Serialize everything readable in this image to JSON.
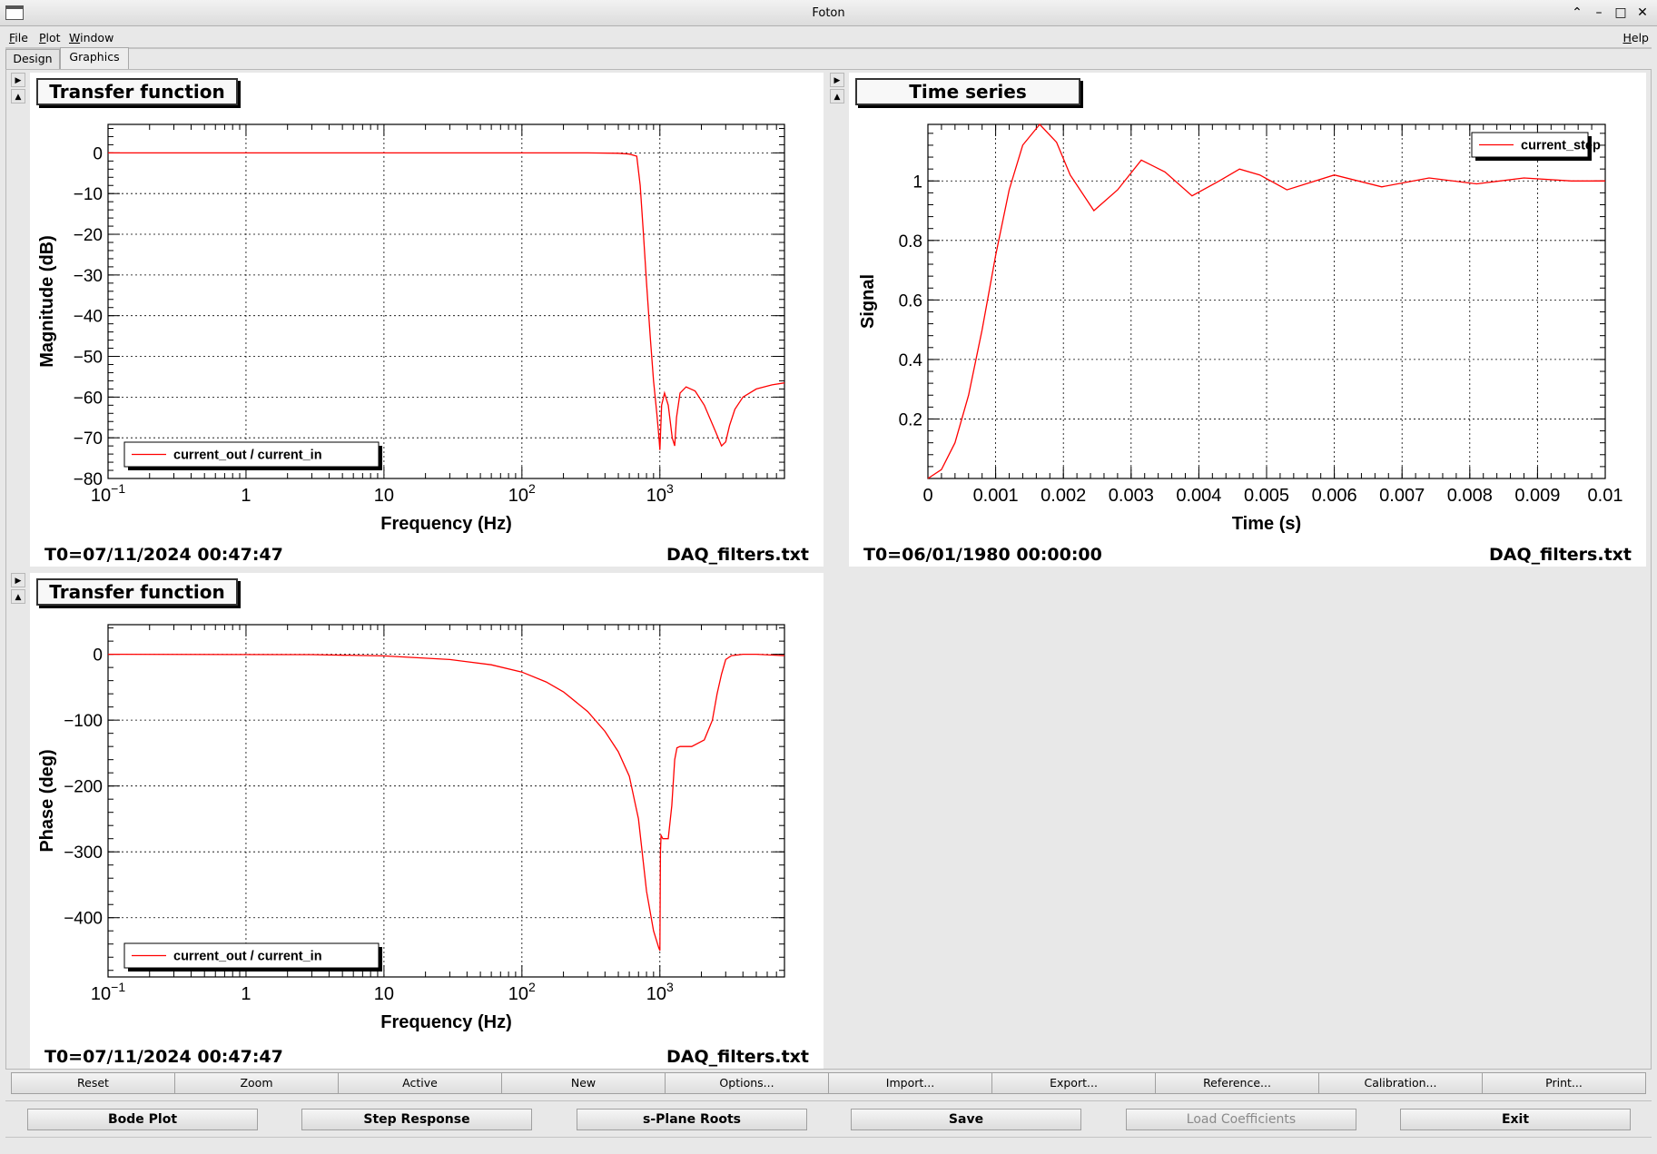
{
  "window": {
    "title": "Foton"
  },
  "window_buttons": [
    {
      "name": "shade-button",
      "glyph": "⌃"
    },
    {
      "name": "minimize-button",
      "glyph": "–"
    },
    {
      "name": "maximize-button",
      "glyph": "□"
    },
    {
      "name": "close-button",
      "glyph": "✕"
    }
  ],
  "menu": {
    "file": "File",
    "plot": "Plot",
    "window": "Window",
    "help": "Help"
  },
  "tabs": {
    "design": "Design",
    "graphics": "Graphics",
    "active": "Graphics"
  },
  "side_buttons": {
    "expand": "▶",
    "collapse": "▲"
  },
  "panels": {
    "mag": {
      "title": "Transfer function",
      "t0": "T0=07/11/2024 00:47:47",
      "file": "DAQ_filters.txt"
    },
    "step": {
      "title": "Time series",
      "t0": "T0=06/01/1980 00:00:00",
      "file": "DAQ_filters.txt"
    },
    "phase": {
      "title": "Transfer function",
      "t0": "T0=07/11/2024 00:47:47",
      "file": "DAQ_filters.txt"
    }
  },
  "toolbar": [
    "Reset",
    "Zoom",
    "Active",
    "New",
    "Options...",
    "Import...",
    "Export...",
    "Reference...",
    "Calibration...",
    "Print..."
  ],
  "actions": {
    "bode": "Bode Plot",
    "step": "Step Response",
    "splane": "s-Plane Roots",
    "save": "Save",
    "load": "Load Coefficients",
    "exit": "Exit"
  },
  "colors": {
    "trace": "#ff0000",
    "background": "#e8e8e8",
    "pad": "#ffffff"
  },
  "chart_data": [
    {
      "type": "line",
      "title": "Transfer function",
      "xlabel": "Frequency (Hz)",
      "ylabel": "Magnitude (dB)",
      "xscale": "log",
      "xlim": [
        0.1,
        8000
      ],
      "ylim": [
        -80,
        7
      ],
      "xticks": [
        0.1,
        1,
        10,
        100,
        1000
      ],
      "xticklabels": [
        "10",
        "1",
        "10",
        "10",
        "10"
      ],
      "xtickexp": [
        "−1",
        "",
        "",
        "2",
        "3"
      ],
      "yticks": [
        0,
        -10,
        -20,
        -30,
        -40,
        -50,
        -60,
        -70,
        -80
      ],
      "yticklabels": [
        "0",
        "−10",
        "−20",
        "−30",
        "−40",
        "−50",
        "−60",
        "−70",
        "−80"
      ],
      "grid": true,
      "legend_position": "bottom-left",
      "series": [
        {
          "name": "current_out / current_in",
          "x": [
            0.1,
            100,
            300,
            500,
            600,
            680,
            720,
            760,
            800,
            850,
            900,
            950,
            985,
            1000,
            1030,
            1080,
            1150,
            1230,
            1280,
            1320,
            1400,
            1550,
            1800,
            2100,
            2500,
            2800,
            3000,
            3200,
            3500,
            4000,
            5000,
            6500,
            8000
          ],
          "y": [
            0,
            0,
            0,
            -0.1,
            -0.3,
            -0.8,
            -8,
            -20,
            -32,
            -45,
            -56,
            -64,
            -70,
            -73,
            -62,
            -59,
            -62,
            -70,
            -72,
            -65,
            -59,
            -57.5,
            -58.5,
            -62,
            -68,
            -72,
            -71,
            -67,
            -63,
            -60,
            -58,
            -57,
            -56.5
          ]
        }
      ]
    },
    {
      "type": "line",
      "title": "Time series",
      "xlabel": "Time (s)",
      "ylabel": "Signal",
      "xlim": [
        0,
        0.01
      ],
      "ylim": [
        0,
        1.19
      ],
      "xticks": [
        0,
        0.001,
        0.002,
        0.003,
        0.004,
        0.005,
        0.006,
        0.007,
        0.008,
        0.009,
        0.01
      ],
      "xticklabels": [
        "0",
        "0.001",
        "0.002",
        "0.003",
        "0.004",
        "0.005",
        "0.006",
        "0.007",
        "0.008",
        "0.009",
        "0.01"
      ],
      "yticks": [
        0.2,
        0.4,
        0.6,
        0.8,
        1
      ],
      "yticklabels": [
        "0.2",
        "0.4",
        "0.6",
        "0.8",
        "1"
      ],
      "grid": true,
      "legend_position": "top-right",
      "series": [
        {
          "name": "current_step",
          "x": [
            0,
            0.0002,
            0.0004,
            0.0006,
            0.0008,
            0.001,
            0.0012,
            0.0014,
            0.00165,
            0.0019,
            0.0021,
            0.00245,
            0.0028,
            0.00315,
            0.0035,
            0.0039,
            0.0043,
            0.0046,
            0.0049,
            0.0053,
            0.006,
            0.0067,
            0.0074,
            0.0081,
            0.0088,
            0.0095,
            0.01
          ],
          "y": [
            0,
            0.03,
            0.12,
            0.28,
            0.5,
            0.75,
            0.97,
            1.12,
            1.19,
            1.13,
            1.02,
            0.9,
            0.97,
            1.07,
            1.03,
            0.95,
            1.0,
            1.04,
            1.02,
            0.97,
            1.02,
            0.98,
            1.01,
            0.99,
            1.01,
            1.0,
            1.0
          ]
        }
      ]
    },
    {
      "type": "line",
      "title": "Transfer function",
      "xlabel": "Frequency (Hz)",
      "ylabel": "Phase (deg)",
      "xscale": "log",
      "xlim": [
        0.1,
        8000
      ],
      "ylim": [
        -490,
        45
      ],
      "xticks": [
        0.1,
        1,
        10,
        100,
        1000
      ],
      "xticklabels": [
        "10",
        "1",
        "10",
        "10",
        "10"
      ],
      "xtickexp": [
        "−1",
        "",
        "",
        "2",
        "3"
      ],
      "yticks": [
        0,
        -100,
        -200,
        -300,
        -400
      ],
      "yticklabels": [
        "0",
        "−100",
        "−200",
        "−300",
        "−400"
      ],
      "grid": true,
      "legend_position": "bottom-left",
      "series": [
        {
          "name": "current_out / current_in",
          "x": [
            0.1,
            3,
            10,
            30,
            60,
            100,
            150,
            200,
            300,
            400,
            500,
            600,
            700,
            800,
            900,
            980,
            1000,
            1010,
            1020,
            1050,
            1150,
            1220,
            1280,
            1330,
            1400,
            1700,
            2100,
            2400,
            2600,
            2800,
            3000,
            3300,
            4000,
            5000,
            8000
          ],
          "y": [
            0,
            -0.5,
            -2.5,
            -8,
            -16,
            -27,
            -42,
            -57,
            -87,
            -117,
            -148,
            -185,
            -250,
            -360,
            -420,
            -445,
            -450,
            -300,
            -275,
            -280,
            -280,
            -230,
            -160,
            -142,
            -140,
            -140,
            -130,
            -100,
            -60,
            -30,
            -8,
            -2,
            0,
            0,
            -2
          ]
        }
      ]
    }
  ]
}
